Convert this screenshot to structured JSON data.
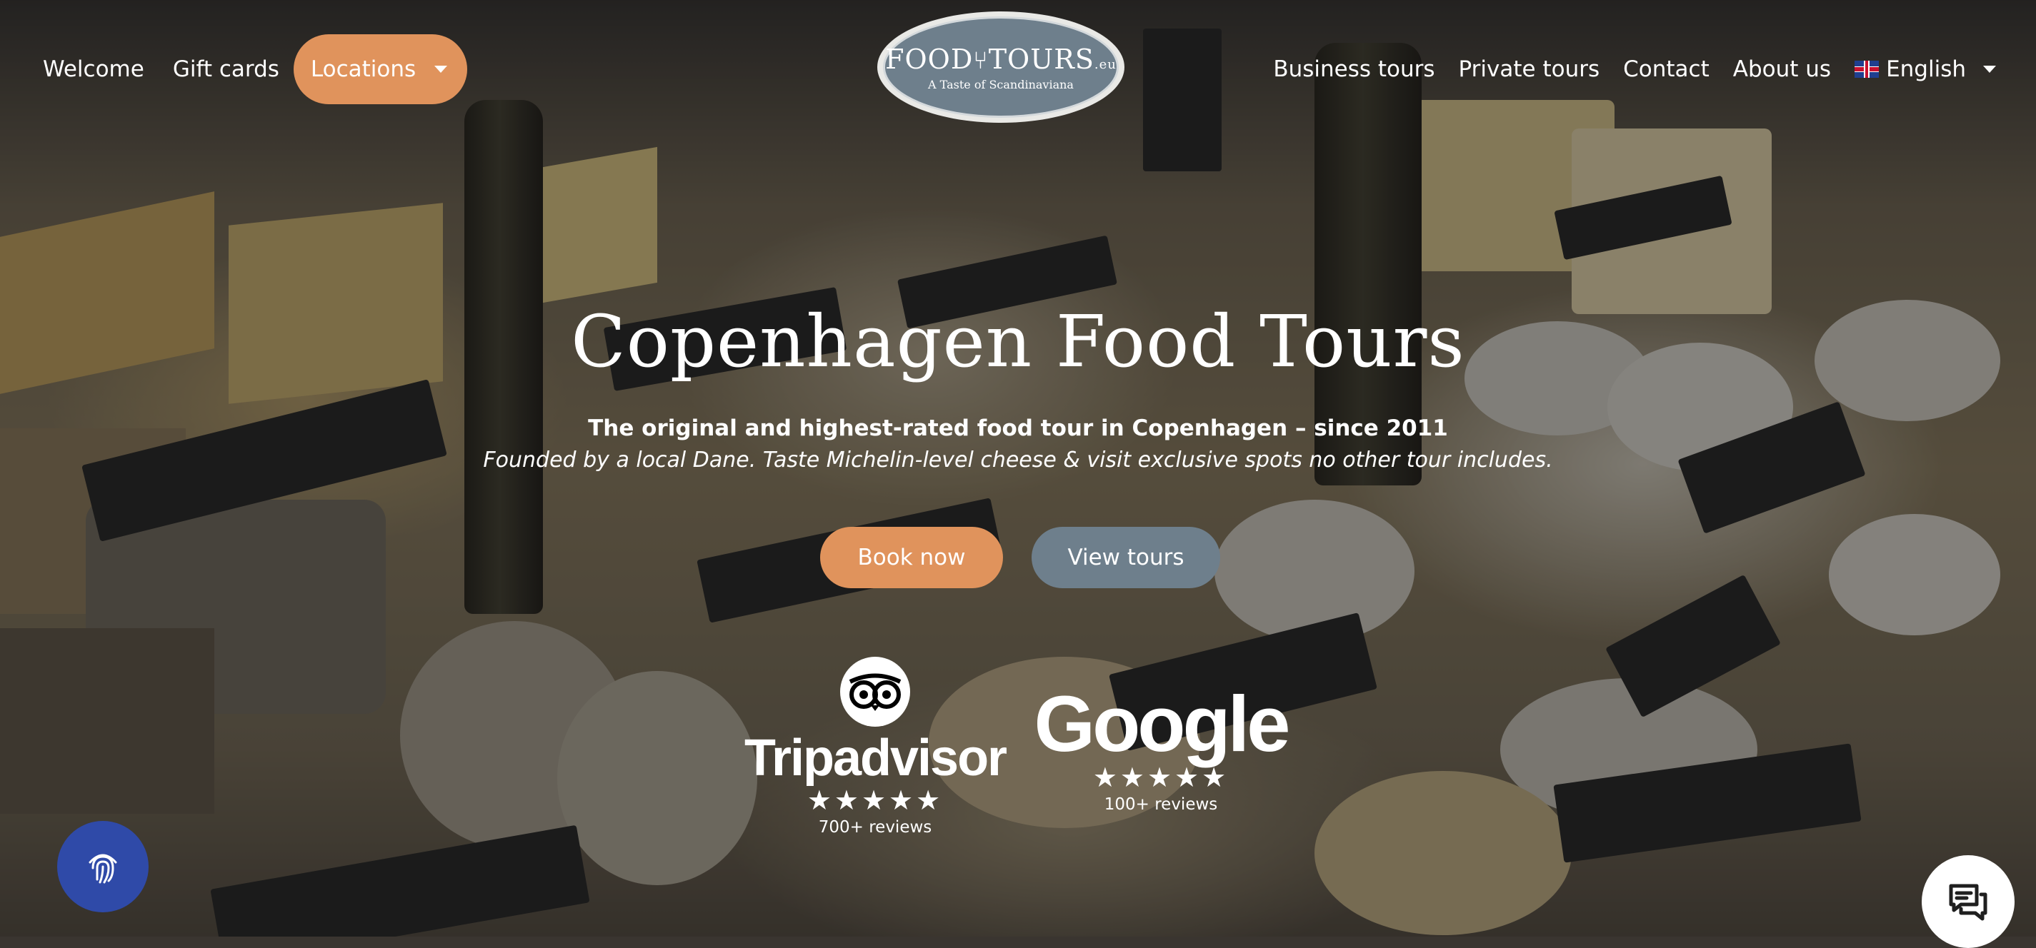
{
  "logo": {
    "main": "FOOD",
    "main2": "TOURS",
    "suffix": ".eu",
    "tagline": "A Taste of Scandinaviana"
  },
  "nav_left": [
    {
      "label": "Welcome"
    },
    {
      "label": "Gift cards"
    }
  ],
  "locations": {
    "label": "Locations"
  },
  "nav_right": [
    {
      "label": "Business tours"
    },
    {
      "label": "Private tours"
    },
    {
      "label": "Contact"
    },
    {
      "label": "About us"
    }
  ],
  "language": {
    "label": "English"
  },
  "hero": {
    "title": "Copenhagen Food Tours",
    "subtitle": "The original and highest-rated food tour in Copenhagen – since 2011",
    "description": "Founded by a local Dane. Taste Michelin-level cheese & visit exclusive spots no other tour includes."
  },
  "buttons": {
    "book": "Book now",
    "view": "View tours"
  },
  "reviews": {
    "tripadvisor": {
      "name": "Tripadvisor",
      "stars": "★★★★★",
      "count": "700+ reviews"
    },
    "google": {
      "name": "Google",
      "stars": "★★★★★",
      "count": "100+ reviews"
    }
  },
  "colors": {
    "accent": "#e0935c",
    "secondary": "#6e7f8c",
    "fingerprint_button": "#2f4aa8"
  },
  "icons": {
    "fingerprint": "fingerprint-icon",
    "chat": "chat-icon",
    "caret": "chevron-down-icon",
    "flag": "uk-flag-icon"
  }
}
